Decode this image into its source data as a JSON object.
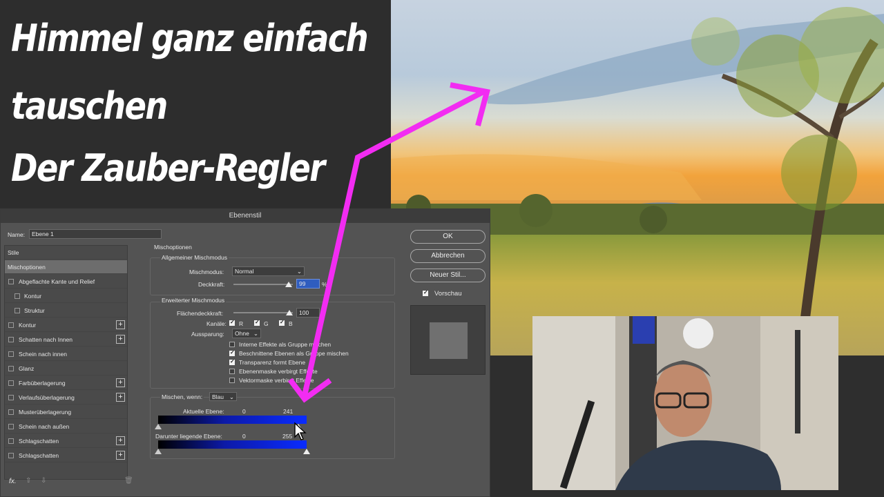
{
  "thumbnail": {
    "title_lines": [
      "Himmel ganz einfach",
      "tauschen",
      "Der Zauber-Regler"
    ],
    "arrow_color": "#f22cf2"
  },
  "dialog": {
    "title": "Ebenenstil",
    "name_label": "Name:",
    "name_value": "Ebene 1",
    "styles": [
      {
        "label": "Stile",
        "type": "header"
      },
      {
        "label": "Mischoptionen",
        "type": "selected"
      },
      {
        "label": "Abgeflachte Kante und Relief",
        "type": "checkbox"
      },
      {
        "label": "Kontur",
        "type": "sub"
      },
      {
        "label": "Struktur",
        "type": "sub"
      },
      {
        "label": "Kontur",
        "type": "checkbox",
        "plus": "+"
      },
      {
        "label": "Schatten nach Innen",
        "type": "checkbox",
        "plus": "+"
      },
      {
        "label": "Schein nach innen",
        "type": "checkbox"
      },
      {
        "label": "Glanz",
        "type": "checkbox"
      },
      {
        "label": "Farbüberlagerung",
        "type": "checkbox",
        "plus": "+"
      },
      {
        "label": "Verlaufsüberlagerung",
        "type": "checkbox",
        "plus": "+"
      },
      {
        "label": "Musterüberlagerung",
        "type": "checkbox"
      },
      {
        "label": "Schein nach außen",
        "type": "checkbox"
      },
      {
        "label": "Schlagschatten",
        "type": "checkbox",
        "plus": "+"
      },
      {
        "label": "Schlagschatten",
        "type": "checkbox",
        "plus": "+"
      }
    ],
    "fx_label": "fx.",
    "section_title": "Mischoptionen",
    "general": {
      "title": "Allgemeiner Mischmodus",
      "mode_label": "Mischmodus:",
      "mode_value": "Normal",
      "opacity_label": "Deckkraft:",
      "opacity_value": "99",
      "opacity_level": 0.99,
      "percent": "%"
    },
    "advanced": {
      "title": "Erweiterter Mischmodus",
      "fill_label": "Flächendeckkraft:",
      "fill_value": "100",
      "fill_level": 1.0,
      "channels_label": "Kanäle:",
      "channels": [
        "R",
        "G",
        "B"
      ],
      "knockout_label": "Aussparung:",
      "knockout_value": "Ohne",
      "options": [
        {
          "label": "Interne Effekte als Gruppe mischen",
          "checked": false
        },
        {
          "label": "Beschnittene Ebenen als Gruppe mischen",
          "checked": true
        },
        {
          "label": "Transparenz formt Ebene",
          "checked": true
        },
        {
          "label": "Ebenenmaske verbirgt Effekte",
          "checked": false
        },
        {
          "label": "Vektormaske verbirgt Effekte",
          "checked": false
        }
      ]
    },
    "blend_if": {
      "label": "Mischen, wenn:",
      "channel": "Blau",
      "current_label": "Aktuelle Ebene:",
      "current_min": "0",
      "current_max": "241",
      "current_max_level": 0.945,
      "below_label": "Darunter liegende Ebene:",
      "below_min": "0",
      "below_max": "255",
      "below_max_level": 1.0
    },
    "buttons": {
      "ok": "OK",
      "cancel": "Abbrechen",
      "new_style": "Neuer Stil...",
      "preview": "Vorschau"
    }
  }
}
